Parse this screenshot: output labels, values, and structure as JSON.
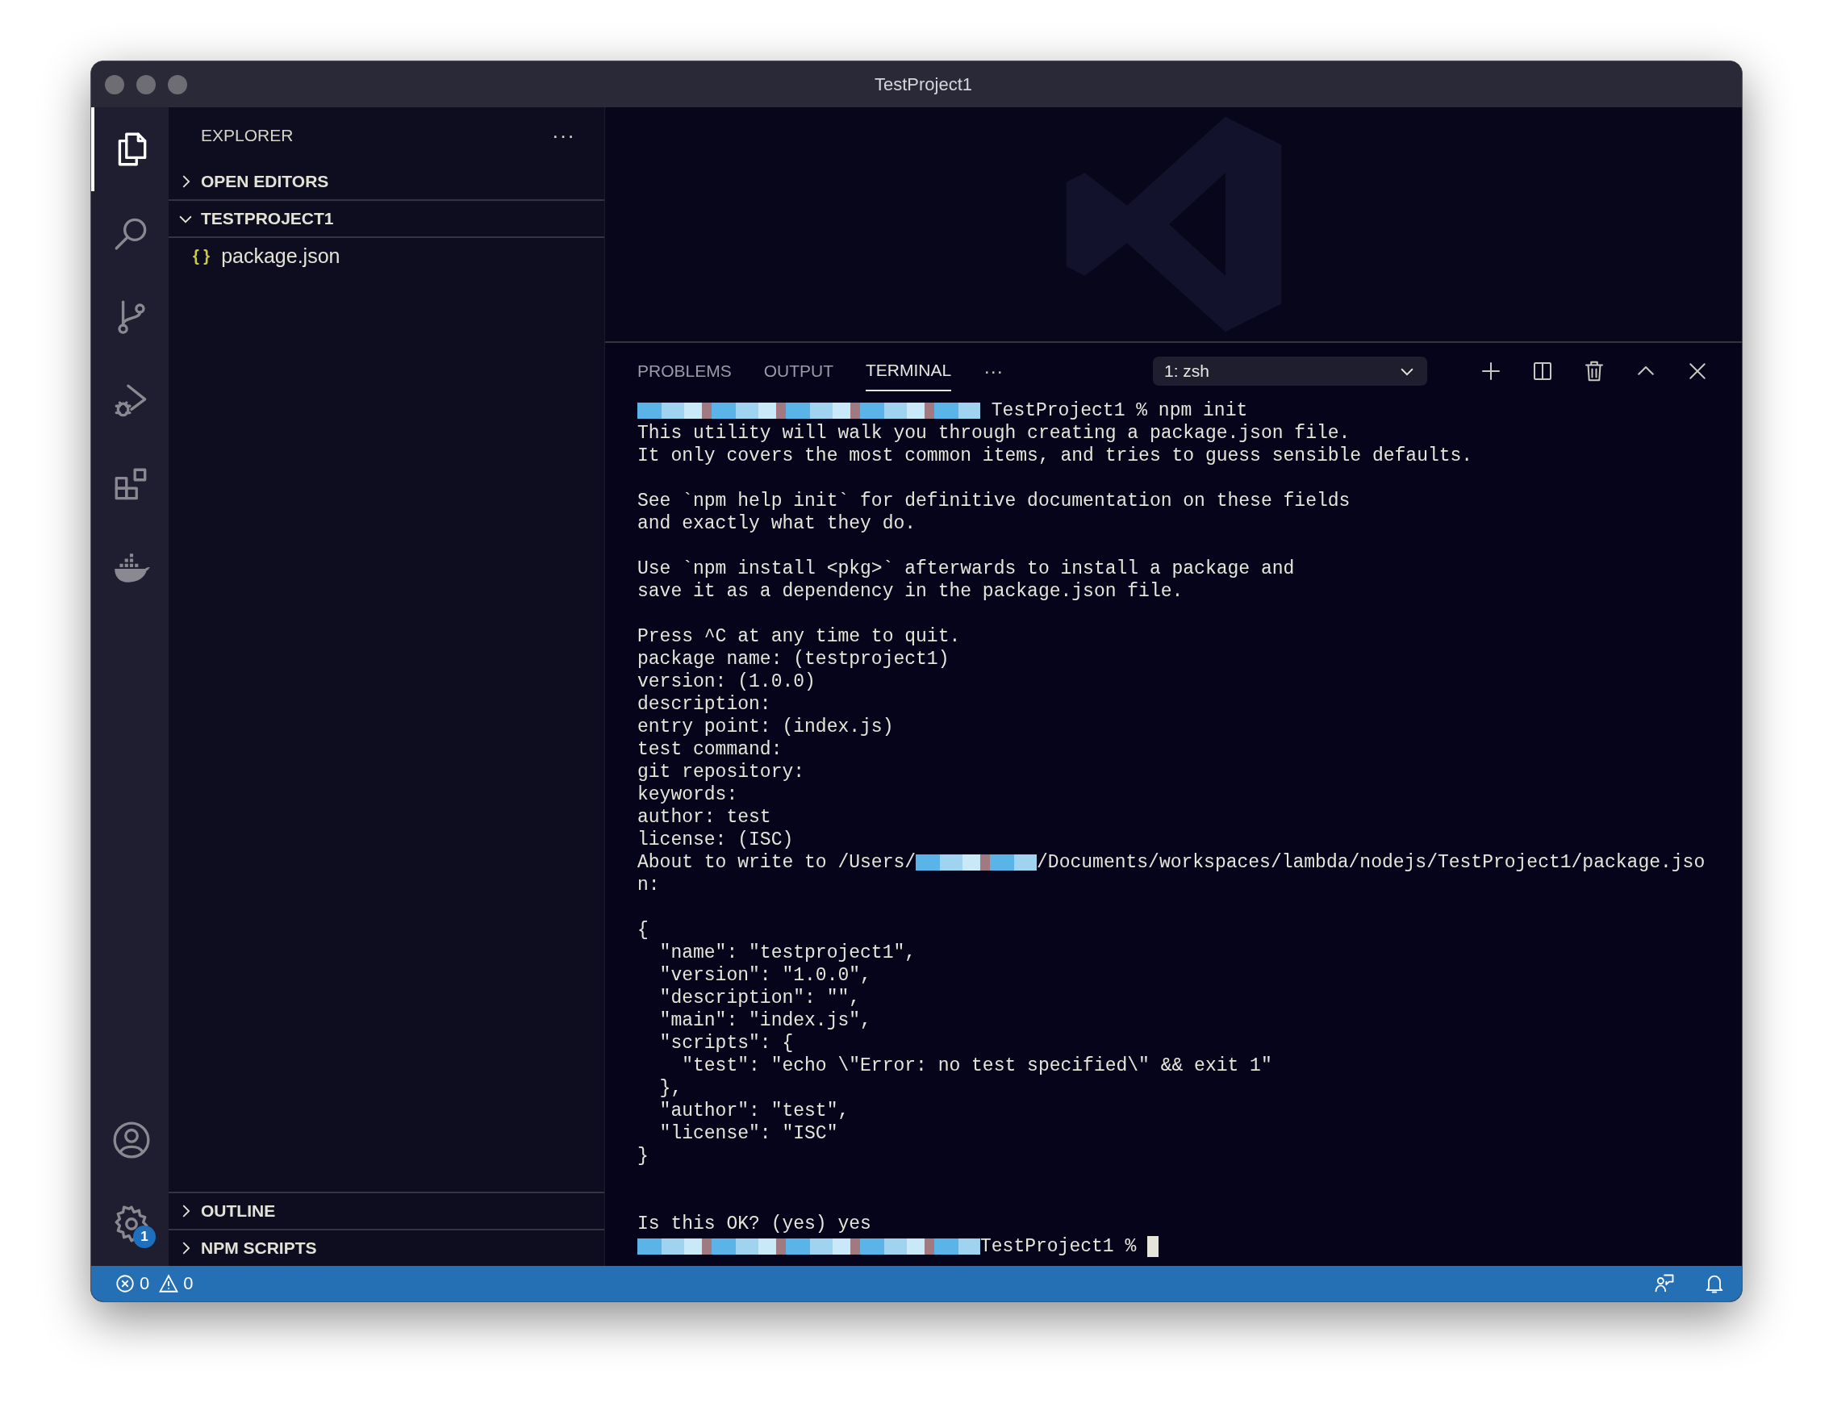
{
  "window": {
    "title": "TestProject1"
  },
  "activity_bar": {
    "items": [
      {
        "kind": "files",
        "selected": true
      },
      {
        "kind": "search",
        "selected": false
      },
      {
        "kind": "source-control",
        "selected": false
      },
      {
        "kind": "run-debug",
        "selected": false
      },
      {
        "kind": "extensions",
        "selected": false
      },
      {
        "kind": "docker",
        "selected": false
      }
    ],
    "bottom": [
      {
        "kind": "account"
      },
      {
        "kind": "settings",
        "badge": "1"
      }
    ]
  },
  "sidebar": {
    "title": "EXPLORER",
    "more": "···",
    "sections": [
      {
        "title": "OPEN EDITORS",
        "expanded": false
      },
      {
        "title": "TESTPROJECT1",
        "expanded": true,
        "items": [
          {
            "glyph": "{ }",
            "label": "package.json"
          }
        ]
      }
    ],
    "bottom_sections": [
      {
        "title": "OUTLINE",
        "expanded": false
      },
      {
        "title": "NPM SCRIPTS",
        "expanded": false
      }
    ]
  },
  "panel": {
    "tabs": [
      {
        "label": "PROBLEMS",
        "selected": false
      },
      {
        "label": "OUTPUT",
        "selected": false
      },
      {
        "label": "TERMINAL",
        "selected": true
      }
    ],
    "more": "···",
    "terminal_select": "1: zsh",
    "actions": [
      {
        "kind": "add"
      },
      {
        "kind": "split"
      },
      {
        "kind": "trash"
      },
      {
        "kind": "maximize"
      },
      {
        "kind": "close"
      }
    ]
  },
  "terminal": {
    "lines": [
      {
        "kind": "text",
        "parts": [
          {
            "kind": "redacted-long"
          },
          {
            "kind": "text",
            "text": " TestProject1 % npm init"
          }
        ]
      },
      {
        "kind": "text",
        "parts": [
          {
            "kind": "text",
            "text": "This utility will walk you through creating a package.json file."
          }
        ]
      },
      {
        "kind": "text",
        "parts": [
          {
            "kind": "text",
            "text": "It only covers the most common items, and tries to guess sensible defaults."
          }
        ]
      },
      {
        "kind": "blank"
      },
      {
        "kind": "text",
        "parts": [
          {
            "kind": "text",
            "text": "See `npm help init` for definitive documentation on these fields"
          }
        ]
      },
      {
        "kind": "text",
        "parts": [
          {
            "kind": "text",
            "text": "and exactly what they do."
          }
        ]
      },
      {
        "kind": "blank"
      },
      {
        "kind": "text",
        "parts": [
          {
            "kind": "text",
            "text": "Use `npm install <pkg>` afterwards to install a package and"
          }
        ]
      },
      {
        "kind": "text",
        "parts": [
          {
            "kind": "text",
            "text": "save it as a dependency in the package.json file."
          }
        ]
      },
      {
        "kind": "blank"
      },
      {
        "kind": "text",
        "parts": [
          {
            "kind": "text",
            "text": "Press ^C at any time to quit."
          }
        ]
      },
      {
        "kind": "text",
        "parts": [
          {
            "kind": "text",
            "text": "package name: (testproject1)"
          }
        ]
      },
      {
        "kind": "text",
        "parts": [
          {
            "kind": "text",
            "text": "version: (1.0.0)"
          }
        ]
      },
      {
        "kind": "text",
        "parts": [
          {
            "kind": "text",
            "text": "description:"
          }
        ]
      },
      {
        "kind": "text",
        "parts": [
          {
            "kind": "text",
            "text": "entry point: (index.js)"
          }
        ]
      },
      {
        "kind": "text",
        "parts": [
          {
            "kind": "text",
            "text": "test command:"
          }
        ]
      },
      {
        "kind": "text",
        "parts": [
          {
            "kind": "text",
            "text": "git repository:"
          }
        ]
      },
      {
        "kind": "text",
        "parts": [
          {
            "kind": "text",
            "text": "keywords:"
          }
        ]
      },
      {
        "kind": "text",
        "parts": [
          {
            "kind": "text",
            "text": "author: test"
          }
        ]
      },
      {
        "kind": "text",
        "parts": [
          {
            "kind": "text",
            "text": "license: (ISC)"
          }
        ]
      },
      {
        "kind": "text",
        "parts": [
          {
            "kind": "text",
            "text": "About to write to /Users/"
          },
          {
            "kind": "redacted-short"
          },
          {
            "kind": "text",
            "text": "/Documents/workspaces/lambda/nodejs/TestProject1/package.jso"
          }
        ]
      },
      {
        "kind": "text",
        "parts": [
          {
            "kind": "text",
            "text": "n:"
          }
        ]
      },
      {
        "kind": "blank"
      },
      {
        "kind": "text",
        "parts": [
          {
            "kind": "text",
            "text": "{"
          }
        ]
      },
      {
        "kind": "text",
        "parts": [
          {
            "kind": "text",
            "text": "  \"name\": \"testproject1\","
          }
        ]
      },
      {
        "kind": "text",
        "parts": [
          {
            "kind": "text",
            "text": "  \"version\": \"1.0.0\","
          }
        ]
      },
      {
        "kind": "text",
        "parts": [
          {
            "kind": "text",
            "text": "  \"description\": \"\","
          }
        ]
      },
      {
        "kind": "text",
        "parts": [
          {
            "kind": "text",
            "text": "  \"main\": \"index.js\","
          }
        ]
      },
      {
        "kind": "text",
        "parts": [
          {
            "kind": "text",
            "text": "  \"scripts\": {"
          }
        ]
      },
      {
        "kind": "text",
        "parts": [
          {
            "kind": "text",
            "text": "    \"test\": \"echo \\\"Error: no test specified\\\" && exit 1\""
          }
        ]
      },
      {
        "kind": "text",
        "parts": [
          {
            "kind": "text",
            "text": "  },"
          }
        ]
      },
      {
        "kind": "text",
        "parts": [
          {
            "kind": "text",
            "text": "  \"author\": \"test\","
          }
        ]
      },
      {
        "kind": "text",
        "parts": [
          {
            "kind": "text",
            "text": "  \"license\": \"ISC\""
          }
        ]
      },
      {
        "kind": "text",
        "parts": [
          {
            "kind": "text",
            "text": "}"
          }
        ]
      },
      {
        "kind": "blank"
      },
      {
        "kind": "blank"
      },
      {
        "kind": "text",
        "parts": [
          {
            "kind": "text",
            "text": "Is this OK? (yes) yes"
          }
        ]
      },
      {
        "kind": "text",
        "parts": [
          {
            "kind": "redacted-long"
          },
          {
            "kind": "text",
            "text": "TestProject1 % "
          },
          {
            "kind": "cursor"
          }
        ]
      }
    ]
  },
  "status_bar": {
    "errors": "0",
    "warnings": "0",
    "right": [
      {
        "kind": "feedback"
      },
      {
        "kind": "bell"
      }
    ]
  }
}
